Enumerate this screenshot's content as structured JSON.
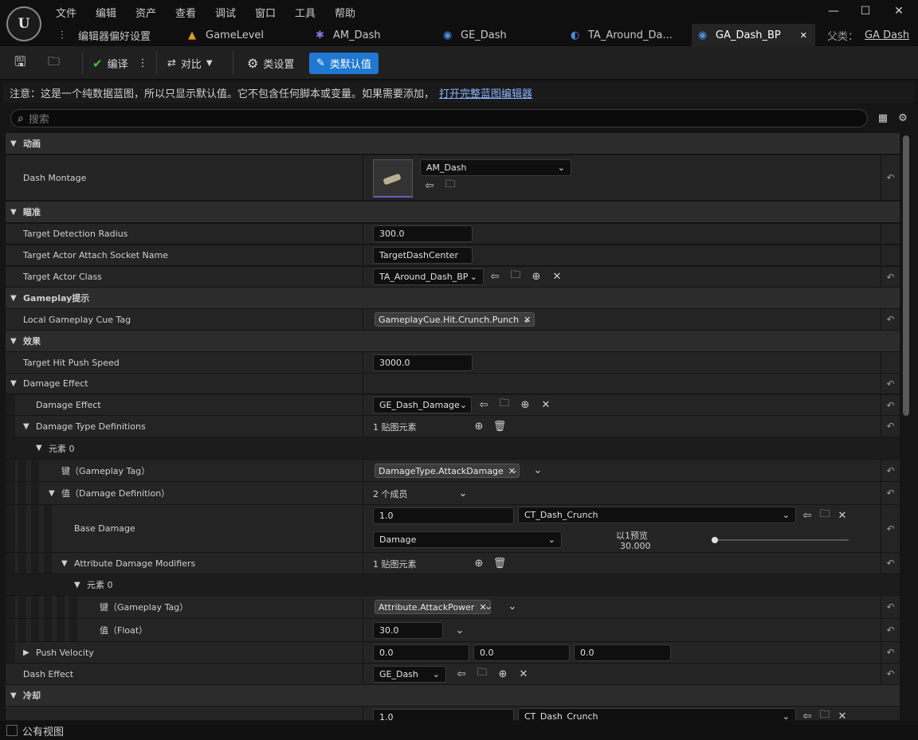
{
  "menu": [
    "文件",
    "编辑",
    "资产",
    "查看",
    "调试",
    "窗口",
    "工具",
    "帮助"
  ],
  "tabs": [
    {
      "label": "编辑器偏好设置"
    },
    {
      "label": "GameLevel"
    },
    {
      "label": "AM_Dash"
    },
    {
      "label": "GE_Dash"
    },
    {
      "label": "TA_Around_Da..."
    },
    {
      "label": "GA_Dash_BP"
    }
  ],
  "parent": {
    "label": "父类：",
    "value": "GA Dash"
  },
  "toolbar": {
    "compile": "编译",
    "diff": "对比",
    "class_settings": "类设置",
    "class_defaults": "类默认值"
  },
  "notice": {
    "text": "注意：这是一个纯数据蓝图，所以只显示默认值。它不包含任何脚本或变量。如果需要添加，",
    "link": "打开完整蓝图编辑器"
  },
  "search": {
    "placeholder": "搜索"
  },
  "props": {
    "cat_anim": "动画",
    "dash_montage": "Dash Montage",
    "dash_montage_value": "AM_Dash",
    "cat_aim": "瞄准",
    "target_detection_radius": "Target Detection Radius",
    "target_detection_radius_value": "300.0",
    "target_actor_attach_socket": "Target Actor Attach Socket Name",
    "target_actor_attach_socket_value": "TargetDashCenter",
    "target_actor_class": "Target Actor Class",
    "target_actor_class_value": "TA_Around_Dash_BP",
    "cat_gameplay_cue": "Gameplay提示",
    "local_gameplay_cue_tag": "Local Gameplay Cue Tag",
    "local_gameplay_cue_tag_value": "GameplayCue.Hit.Crunch.Punch",
    "cat_effect": "效果",
    "target_hit_push_speed": "Target Hit Push Speed",
    "target_hit_push_speed_value": "3000.0",
    "damage_effect_group": "Damage Effect",
    "damage_effect": "Damage Effect",
    "damage_effect_value": "GE_Dash_Damage",
    "damage_type_definitions": "Damage Type Definitions",
    "damage_type_definitions_value": "1 贴图元素",
    "element0": "元素 0",
    "key_tag": "键（Gameplay Tag）",
    "key_tag_value": "DamageType.AttackDamage",
    "value_def": "值（Damage Definition）",
    "value_def_value": "2 个成员",
    "base_damage": "Base Damage",
    "base_damage_value": "1.0",
    "base_damage_curve": "CT_Dash_Crunch",
    "base_damage_row": "Damage",
    "preview_label": "以1预览",
    "preview_value": "30.000",
    "attr_mods": "Attribute Damage Modifiers",
    "attr_mods_value": "1 贴图元素",
    "element0_b": "元素 0",
    "key_tag_b": "键（Gameplay Tag）",
    "key_tag_b_value": "Attribute.AttackPower",
    "value_float": "值（Float）",
    "value_float_value": "30.0",
    "push_velocity": "Push Velocity",
    "push_velocity_x": "0.0",
    "push_velocity_y": "0.0",
    "push_velocity_z": "0.0",
    "dash_effect": "Dash Effect",
    "dash_effect_value": "GE_Dash",
    "cat_cooldown": "冷却",
    "cooldown_value": "1.0",
    "cooldown_curve": "CT_Dash_Crunch"
  },
  "status": {
    "public_view": "公有视图"
  }
}
